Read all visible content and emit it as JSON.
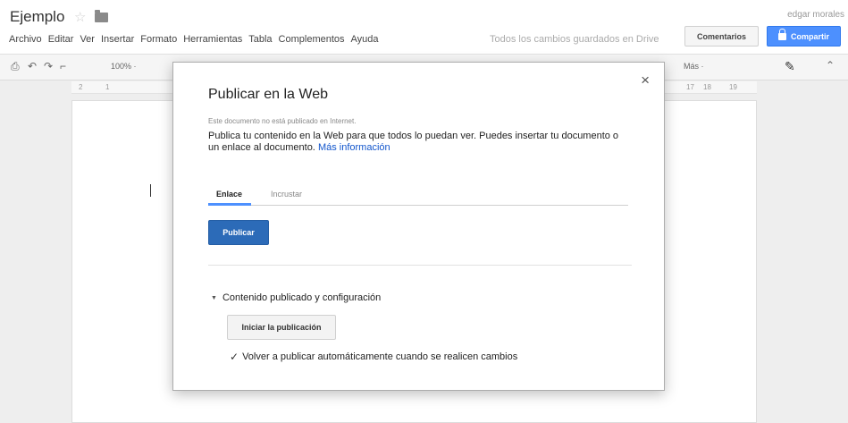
{
  "header": {
    "doc_title": "Ejemplo",
    "user_name": "edgar morales",
    "save_status": "Todos los cambios guardados en Drive",
    "comments_button": "Comentarios",
    "share_button": "Compartir"
  },
  "menu": {
    "items": [
      "Archivo",
      "Editar",
      "Ver",
      "Insertar",
      "Formato",
      "Herramientas",
      "Tabla",
      "Complementos",
      "Ayuda"
    ]
  },
  "toolbar": {
    "zoom": "100% ·",
    "more": "Más ·"
  },
  "ruler": {
    "left_ticks": [
      "2",
      "1"
    ],
    "right_ticks": [
      "17",
      "18",
      "19"
    ]
  },
  "modal": {
    "title": "Publicar en la Web",
    "close_glyph": "×",
    "not_published_notice": "Este documento no está publicado en Internet.",
    "description": "Publica tu contenido en la Web para que todos lo puedan ver. Puedes insertar tu documento o un enlace al documento.",
    "more_info_link": "Más información",
    "tabs": [
      {
        "label": "Enlace",
        "active": true
      },
      {
        "label": "Incrustar",
        "active": false
      }
    ],
    "publish_button": "Publicar",
    "section_label": "Contenido publicado y configuración",
    "stop_publishing_button": "Iniciar la publicación",
    "auto_republish_label": "Volver a publicar automáticamente cuando se realicen cambios",
    "auto_republish_checked": true
  },
  "colors": {
    "accent": "#4d90fe",
    "publish_button": "#2c6bb8",
    "link": "#1155cc"
  }
}
